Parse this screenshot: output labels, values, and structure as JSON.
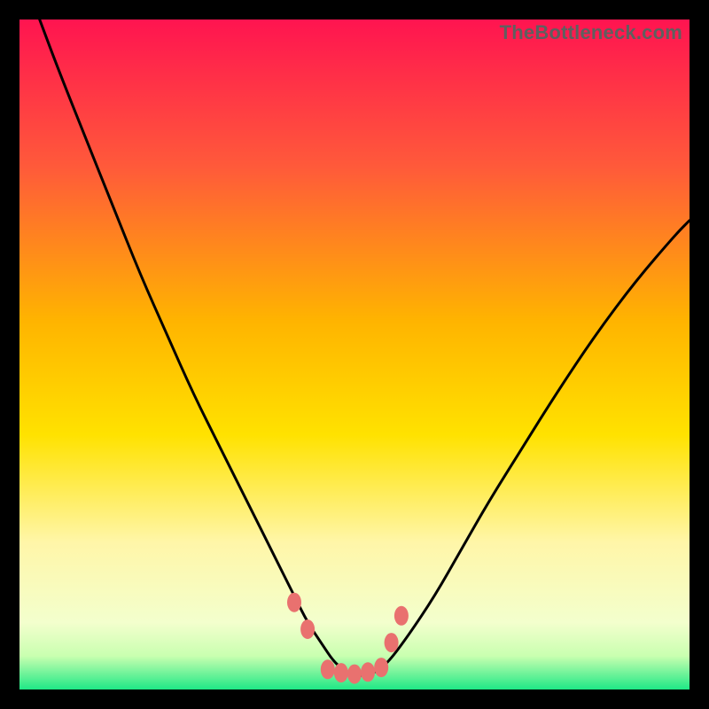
{
  "watermark": "TheBottleneck.com",
  "chart_data": {
    "type": "line",
    "title": "",
    "xlabel": "",
    "ylabel": "",
    "xlim": [
      0,
      100
    ],
    "ylim": [
      0,
      100
    ],
    "grid": false,
    "legend": false,
    "background_gradient": {
      "top_color": "#ff1450",
      "mid_upper_color": "#ff7a2a",
      "mid_color": "#ffd600",
      "mid_lower_color": "#fff3a0",
      "lower_color": "#f6ffd8",
      "bottom_color": "#1fe886"
    },
    "series": [
      {
        "name": "bottleneck-curve",
        "color": "#000000",
        "x": [
          3,
          6,
          10,
          14,
          18,
          22,
          26,
          30,
          34,
          38,
          41,
          43,
          45,
          47,
          49,
          51,
          53,
          55,
          58,
          62,
          66,
          70,
          75,
          80,
          86,
          92,
          98,
          100
        ],
        "y": [
          100,
          92,
          82,
          72,
          62,
          53,
          44,
          36,
          28,
          20,
          14,
          10,
          7,
          4,
          2.5,
          2,
          2.5,
          4,
          8,
          14,
          21,
          28,
          36,
          44,
          53,
          61,
          68,
          70
        ]
      }
    ],
    "markers": [
      {
        "name": "marker-left-upper",
        "x": 41.0,
        "y": 13.0,
        "color": "#e9716f"
      },
      {
        "name": "marker-left-lower",
        "x": 43.0,
        "y": 9.0,
        "color": "#e9716f"
      },
      {
        "name": "marker-right-upper",
        "x": 57.0,
        "y": 11.0,
        "color": "#e9716f"
      },
      {
        "name": "marker-right-lower",
        "x": 55.5,
        "y": 7.0,
        "color": "#e9716f"
      },
      {
        "name": "marker-floor-1",
        "x": 46.0,
        "y": 3.0,
        "color": "#e9716f"
      },
      {
        "name": "marker-floor-2",
        "x": 48.0,
        "y": 2.5,
        "color": "#e9716f"
      },
      {
        "name": "marker-floor-3",
        "x": 50.0,
        "y": 2.3,
        "color": "#e9716f"
      },
      {
        "name": "marker-floor-4",
        "x": 52.0,
        "y": 2.6,
        "color": "#e9716f"
      },
      {
        "name": "marker-floor-5",
        "x": 54.0,
        "y": 3.3,
        "color": "#e9716f"
      }
    ]
  }
}
